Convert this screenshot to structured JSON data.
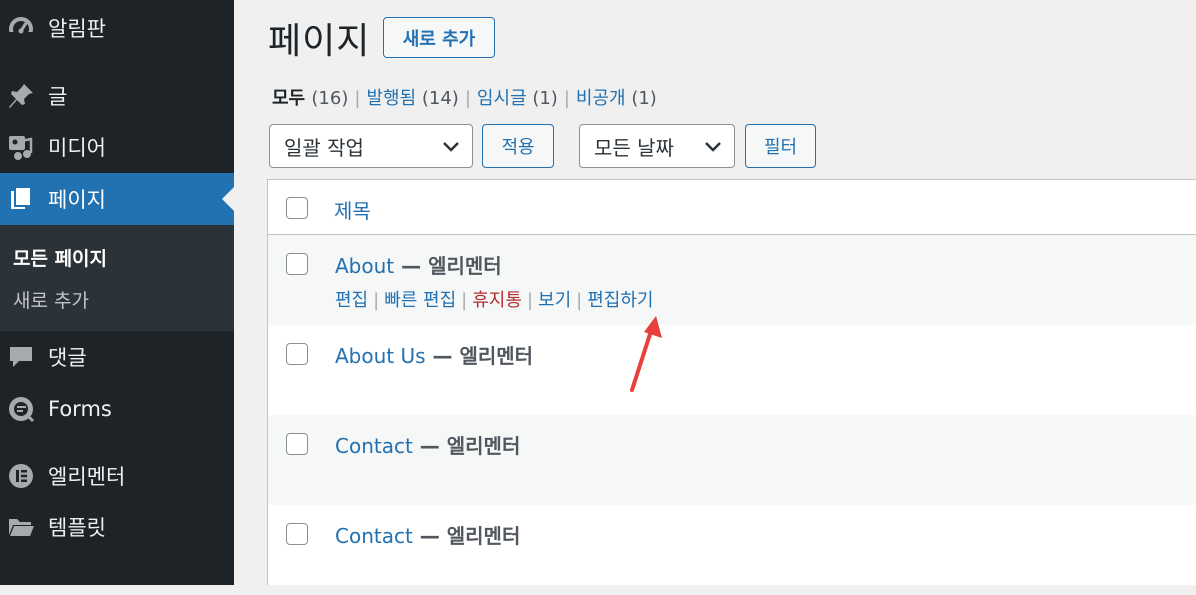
{
  "sidebar": {
    "items": [
      {
        "label": "알림판",
        "icon": "dashboard-icon"
      },
      {
        "label": "글",
        "icon": "pin-icon"
      },
      {
        "label": "미디어",
        "icon": "media-icon"
      },
      {
        "label": "페이지",
        "icon": "pages-icon",
        "active": true
      },
      {
        "label": "댓글",
        "icon": "comment-icon"
      },
      {
        "label": "Forms",
        "icon": "forms-icon"
      },
      {
        "label": "엘리멘터",
        "icon": "elementor-icon"
      },
      {
        "label": "템플릿",
        "icon": "folder-icon"
      }
    ],
    "submenu": [
      {
        "label": "모든 페이지",
        "current": true
      },
      {
        "label": "새로 추가"
      }
    ]
  },
  "header": {
    "title": "페이지",
    "add_new": "새로 추가"
  },
  "filters": [
    {
      "label": "모두",
      "count": "(16)",
      "current": true
    },
    {
      "label": "발행됨",
      "count": "(14)"
    },
    {
      "label": "임시글",
      "count": "(1)"
    },
    {
      "label": "비공개",
      "count": "(1)"
    }
  ],
  "filter_sep": "|",
  "toolbar": {
    "bulk_action": "일괄 작업",
    "apply": "적용",
    "date": "모든 날짜",
    "filter": "필터"
  },
  "table": {
    "column_title": "제목",
    "rows": [
      {
        "title": "About",
        "state": " — 엘리멘터",
        "show_actions": true
      },
      {
        "title": "About Us",
        "state": " — 엘리멘터"
      },
      {
        "title": "Contact",
        "state": " — 엘리멘터"
      },
      {
        "title": "Contact",
        "state": " — 엘리멘터"
      }
    ],
    "row_actions": {
      "edit": "편집",
      "quick_edit": "빠른 편집",
      "trash": "휴지통",
      "view": "보기",
      "edit_with": "편집하기",
      "sep": "|"
    }
  },
  "colors": {
    "accent": "#2271b1",
    "sidebar_bg": "#1d2327",
    "trash": "#b32d2e",
    "arrow": "#e8403a"
  }
}
